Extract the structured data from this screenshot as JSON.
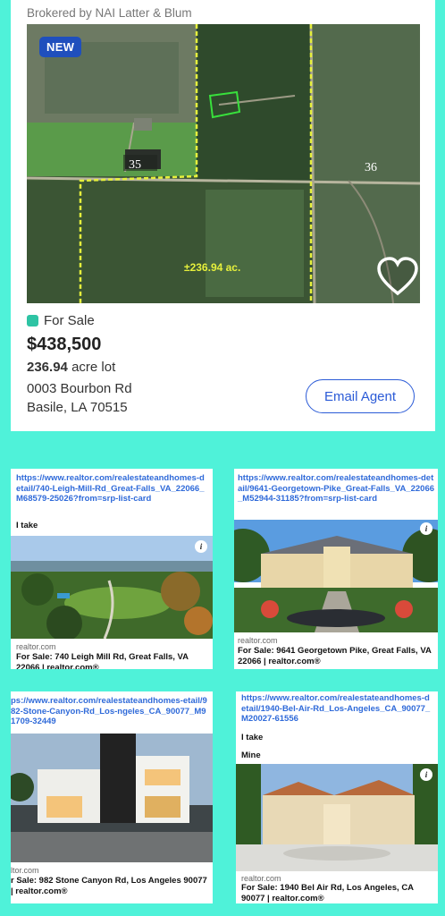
{
  "listing": {
    "broker": "Brokered by NAI Latter & Blum",
    "badge": "NEW",
    "map_labels": {
      "section_a": "35",
      "section_b": "36",
      "acreage": "±236.94 ac."
    },
    "status": "For Sale",
    "price": "$438,500",
    "lot_size": "236.94",
    "lot_unit": "acre lot",
    "address_line1": "0003 Bourbon Rd",
    "address_line2": "Basile, LA 70515",
    "email_button": "Email Agent",
    "colors": {
      "accent": "#2b5bd7",
      "status": "#2ec4a4",
      "badge": "#1f4fbd"
    }
  },
  "tiles": [
    {
      "url": "https://www.realtor.com/realestateandhomes-detail/740-Leigh-Mill-Rd_Great-Falls_VA_22066_M68579-25026?from=srp-list-card",
      "notes": [
        "I take"
      ],
      "site": "realtor.com",
      "caption": "For Sale: 740 Leigh Mill Rd, Great Falls, VA 22066 | realtor.com®"
    },
    {
      "url": "https://www.realtor.com/realestateandhomes-detail/9641-Georgetown-Pike_Great-Falls_VA_22066_M52944-31185?from=srp-list-card",
      "notes": [],
      "site": "realtor.com",
      "caption": "For Sale: 9641 Georgetown Pike, Great Falls, VA 22066 | realtor.com®"
    },
    {
      "url": "ps://www.realtor.com/realestateandhomes-etail/982-Stone-Canyon-Rd_Los-ngeles_CA_90077_M91709-32449",
      "notes": [],
      "site": "ltor.com",
      "caption": "r Sale: 982 Stone Canyon Rd, Los Angeles 90077 | realtor.com®"
    },
    {
      "url": "https://www.realtor.com/realestateandhomes-detail/1940-Bel-Air-Rd_Los-Angeles_CA_90077_M20027-61556",
      "notes": [
        "I take",
        "Mine"
      ],
      "site": "realtor.com",
      "caption": "For Sale: 1940 Bel Air Rd, Los Angeles, CA 90077 | realtor.com®"
    }
  ],
  "icons": {
    "info": "i",
    "heart": "heart-outline-icon"
  }
}
